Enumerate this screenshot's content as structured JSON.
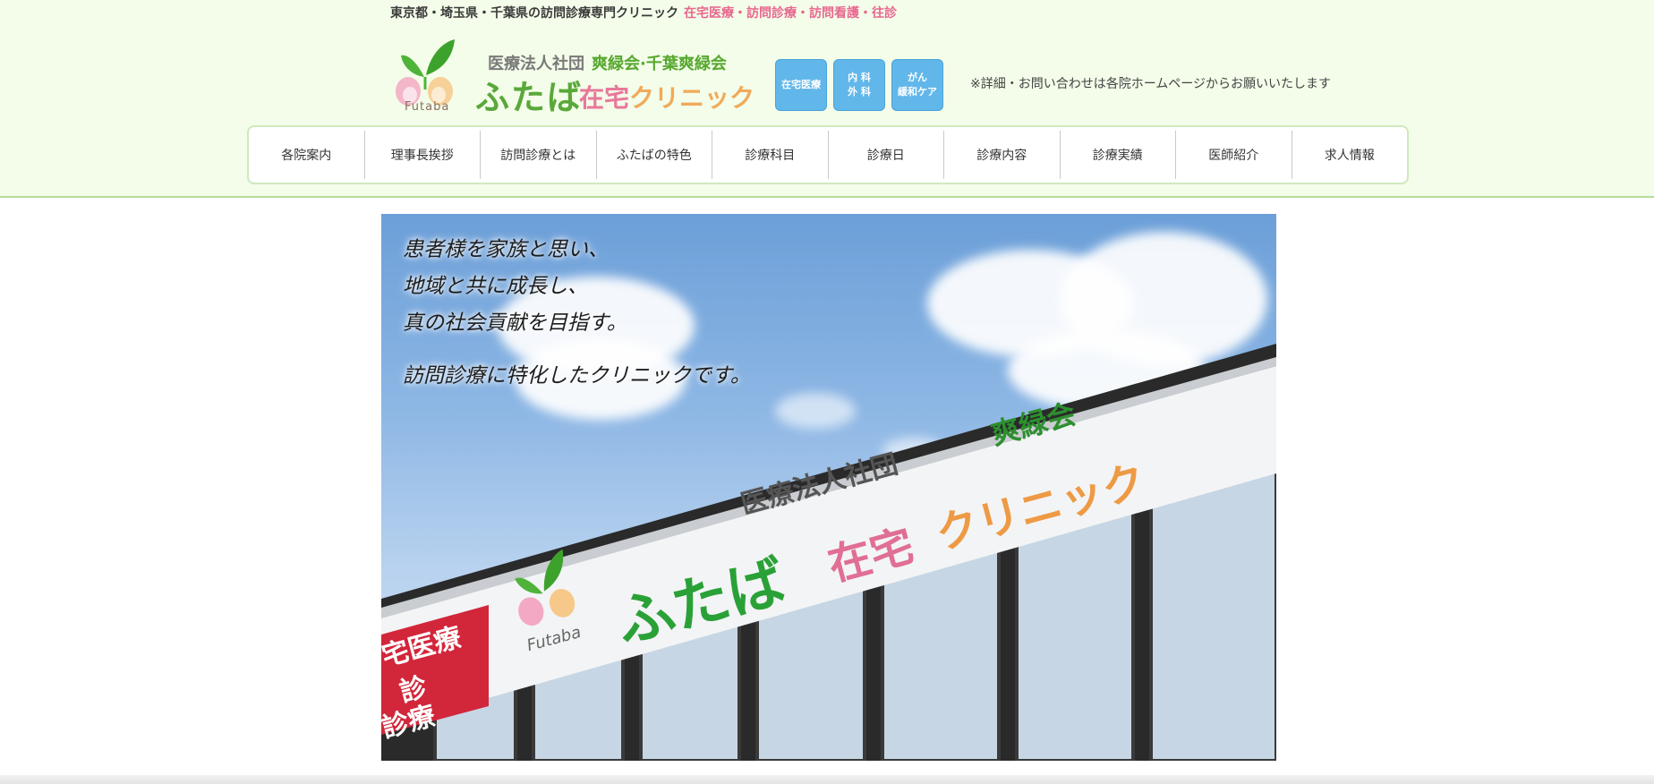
{
  "header": {
    "tagline": "東京都・埼玉県・千葉県の訪問診療専門クリニック",
    "tagline_accent": "在宅医療・訪問診療・訪問看護・往診",
    "note": "※詳細・お問い合わせは各院ホームページからお願いいたします"
  },
  "logo": {
    "futaba": "Futaba",
    "corp": "医療法人社団",
    "corp2": "爽緑会·千葉爽緑会",
    "name": "ふたば",
    "sub_a": "在宅",
    "sub_b": "クリニック"
  },
  "badges": [
    {
      "line1": "在宅医療",
      "line2": ""
    },
    {
      "line1": "内 科",
      "line2": "外 科"
    },
    {
      "line1": "がん",
      "line2": "緩和ケア"
    }
  ],
  "nav": {
    "items": [
      {
        "label": "各院案内"
      },
      {
        "label": "理事長挨拶"
      },
      {
        "label": "訪問診療とは"
      },
      {
        "label": "ふたばの特色"
      },
      {
        "label": "診療科目"
      },
      {
        "label": "診療日"
      },
      {
        "label": "診療内容"
      },
      {
        "label": "診療実績"
      },
      {
        "label": "医師紹介"
      },
      {
        "label": "求人情報"
      }
    ]
  },
  "hero": {
    "slogan": [
      "患者様を家族と思い、",
      "地域と共に成長し、",
      "真の社会貢献を目指す。"
    ],
    "slogan2": "訪問診療に特化したクリニックです。",
    "sign_corp": "医療法人社団",
    "sign_corp2": "爽緑会",
    "sign_name": "ふたば",
    "sign_sub_a": "在宅",
    "sign_sub_b": "クリニック",
    "sign_futaba": "Futaba",
    "sign_red": [
      "宅医療",
      "診",
      "診療"
    ]
  },
  "colors": {
    "header_bg": "#f3fde9",
    "accent_pink": "#e8678f",
    "brand_green": "#5aa83a",
    "badge_blue": "#62b7ea"
  }
}
